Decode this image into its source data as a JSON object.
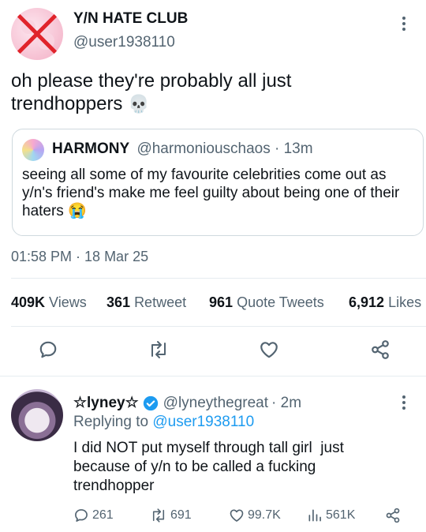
{
  "tweet": {
    "display_name": "Y/N HATE CLUB",
    "handle": "@user1938110",
    "text": "oh please they're probably all just trendhoppers",
    "emoji": "💀",
    "timestamp": "01:58 PM · 18 Mar 25"
  },
  "quote": {
    "display_name": "HARMONY",
    "handle": "@harmoniouschaos",
    "time": "· 13m",
    "text": "seeing all some of my favourite celebrities come out as y/n's friend's make me feel guilty about being one of their haters",
    "emoji": "😭"
  },
  "stats": {
    "views_count": "409K",
    "views_label": "Views",
    "retweets_count": "361",
    "retweets_label": "Retweet",
    "quotes_count": "961",
    "quotes_label": "Quote Tweets",
    "likes_count": "6,912",
    "likes_label": "Likes"
  },
  "reply": {
    "display_name": "☆lyney☆",
    "handle": "@lyneythegreat",
    "time": "· 2m",
    "replying_prefix": "Replying to",
    "replying_to": "@user1938110",
    "text": "I did NOT put myself through tall girl  just because of y/n to be called a fucking trendhopper",
    "actions": {
      "replies": "261",
      "retweets": "691",
      "likes": "99.7K",
      "views": "561K"
    }
  },
  "colors": {
    "accent": "#1d9bf0",
    "secondary_text": "#536471",
    "divider": "#e6ecf0"
  }
}
